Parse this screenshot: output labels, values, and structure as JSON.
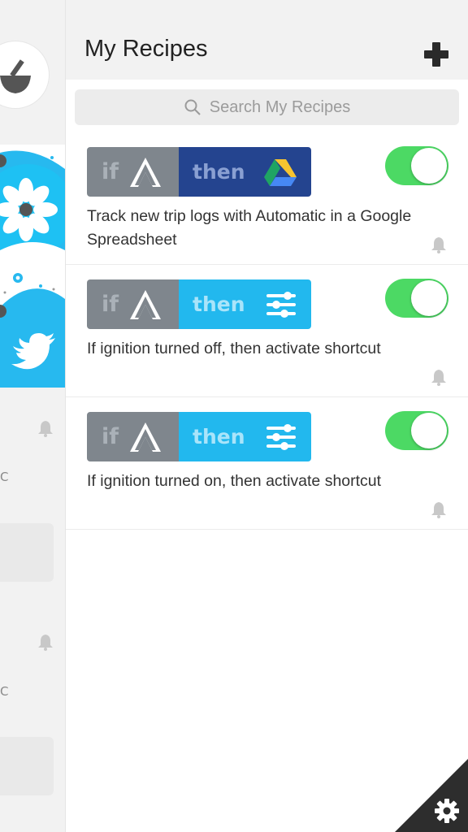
{
  "header": {
    "title": "My Recipes",
    "add_icon": "plus-icon"
  },
  "search": {
    "placeholder": "Search My Recipes",
    "icon": "search-icon"
  },
  "recipes": [
    {
      "if_label": "if",
      "then_label": "then",
      "trigger_icon": "automatic-logo-icon",
      "action_icon": "google-drive-icon",
      "then_color": "#24448f",
      "description": "Track new trip logs with Automatic in a Google Spreadsheet",
      "enabled": true
    },
    {
      "if_label": "if",
      "then_label": "then",
      "trigger_icon": "automatic-logo-icon",
      "action_icon": "do-button-sliders-icon",
      "then_color": "#22b8ee",
      "description": "If ignition turned off, then activate shortcut",
      "enabled": true
    },
    {
      "if_label": "if",
      "then_label": "then",
      "trigger_icon": "automatic-logo-icon",
      "action_icon": "do-button-sliders-icon",
      "then_color": "#22b8ee",
      "description": "If ignition turned on, then activate shortcut",
      "enabled": true
    }
  ],
  "left": {
    "c1": "C",
    "c2": "C"
  },
  "colors": {
    "toggle_on": "#4cd964",
    "if_gray": "#7f868d",
    "banner": "#27b9ef"
  }
}
